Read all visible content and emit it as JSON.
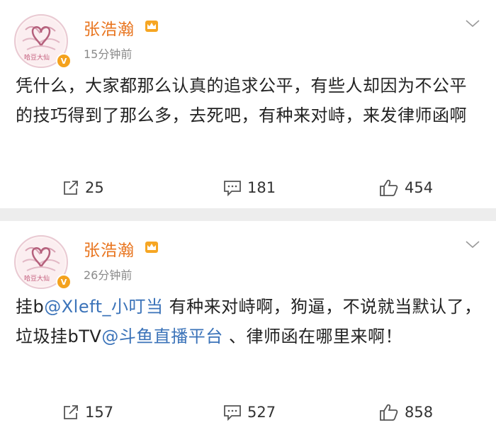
{
  "posts": [
    {
      "author": "张浩瀚",
      "time": "15分钟前",
      "content": "凭什么，大家都那么认真的追求公平，有些人却因为不公平的技巧得到了那么多，去死吧，有种来对峙，来发律师函啊",
      "counts": {
        "repost": "25",
        "comment": "181",
        "like": "454"
      }
    },
    {
      "author": "张浩瀚",
      "time": "26分钟前",
      "content_parts": {
        "p1": "挂b",
        "mention1": "@Xleft_小叮当",
        "p2": " 有种来对峙啊，狗逼，不说就当默认了，垃圾挂bTV",
        "mention2": "@斗鱼直播平台",
        "p3": " 、律师函在哪里来啊！"
      },
      "counts": {
        "repost": "157",
        "comment": "527",
        "like": "858"
      }
    }
  ],
  "avatar": {
    "signature_text": "哈豆大仙",
    "verified_badge": "V"
  },
  "icons": {
    "repost": "repost-icon",
    "comment": "comment-icon",
    "like": "thumbs-up-icon",
    "menu": "chevron-down-icon",
    "member": "crown-icon"
  },
  "colors": {
    "author_name": "#e8741e",
    "mention": "#3b73b9",
    "timestamp": "#8a8a8a",
    "separator": "#ededed",
    "verified": "#f4a21d"
  }
}
